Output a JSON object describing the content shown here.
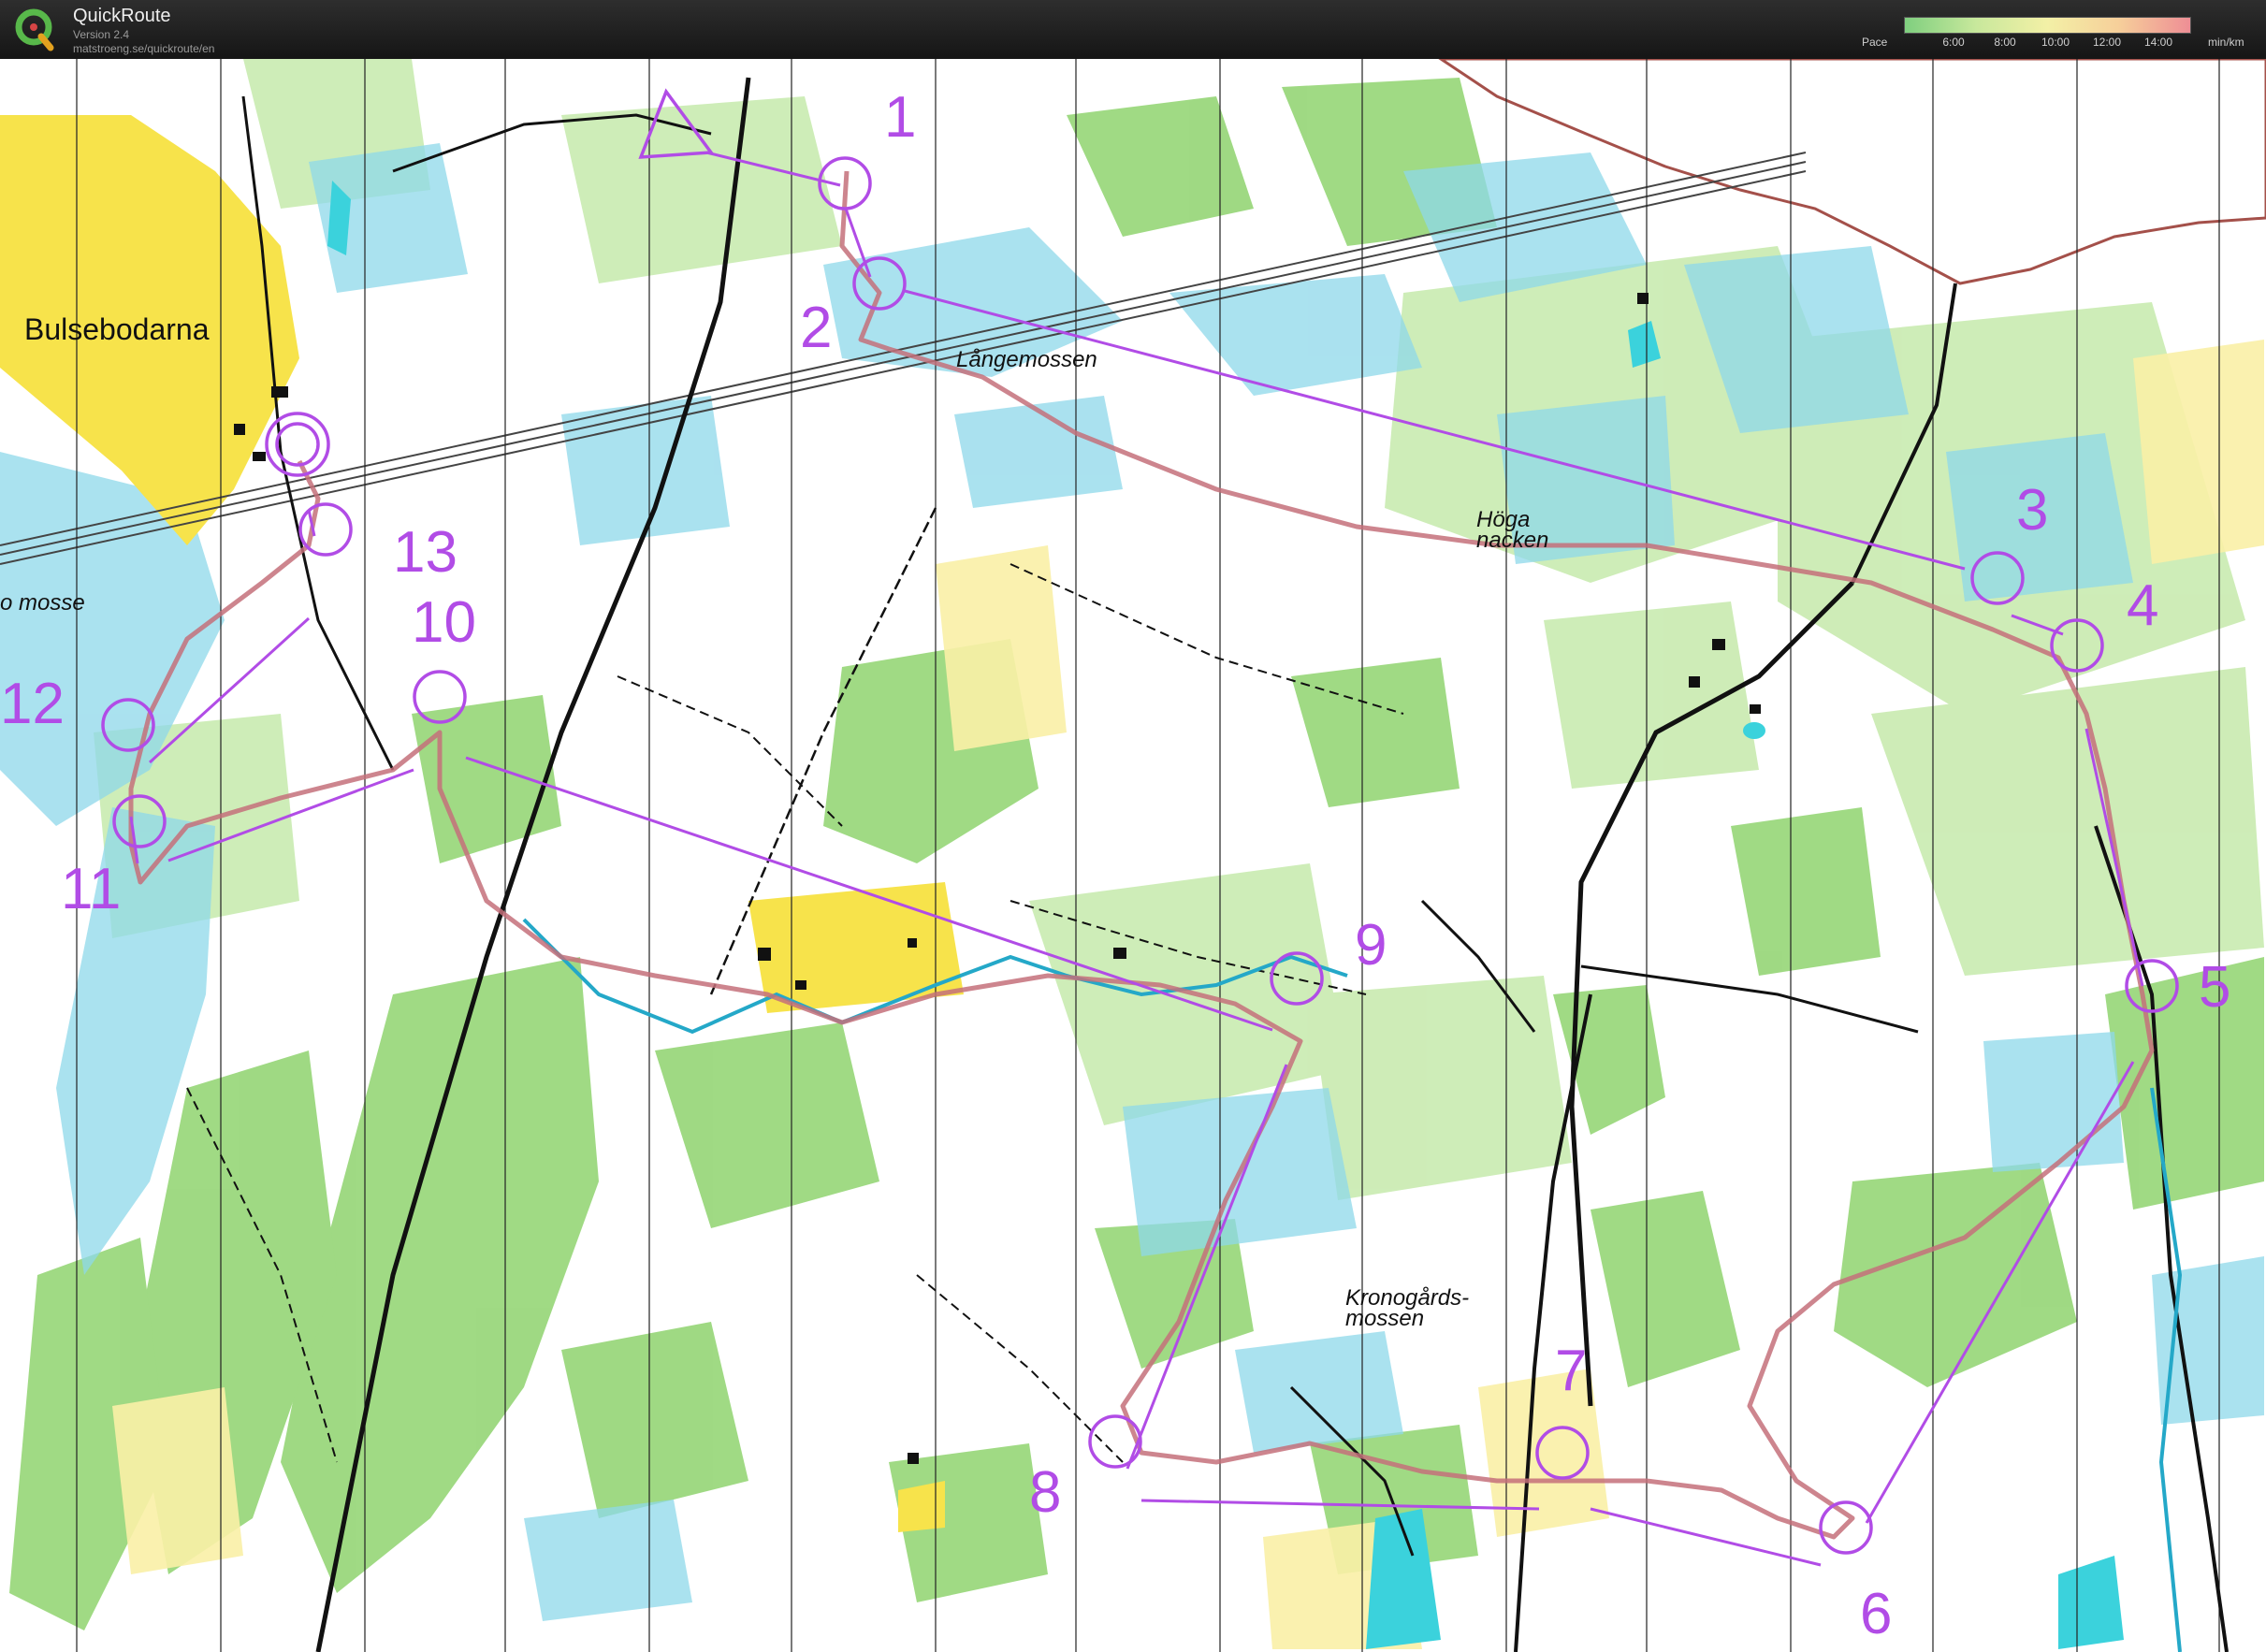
{
  "app": {
    "title": "QuickRoute",
    "version": "Version 2.4",
    "url": "matstroeng.se/quickroute/en"
  },
  "pace_legend": {
    "label": "Pace",
    "ticks": [
      "6:00",
      "8:00",
      "10:00",
      "12:00",
      "14:00"
    ],
    "unit": "min/km",
    "colors": [
      "#7fcf7f",
      "#c8e89c",
      "#f3f0a6",
      "#f6cf9a",
      "#ee8e95"
    ]
  },
  "map": {
    "place_names": {
      "bulsebodarna": "Bulsebodarna",
      "langemossen": "Långemossen",
      "hoga": "Höga",
      "nacken": "nacken",
      "mosse": "o mosse",
      "kronogards": "Kronogårds-",
      "kronogards_2": "mossen"
    },
    "colors": {
      "course": "#b14ce6",
      "route": "#c4707a",
      "open_land": "#f7e34b",
      "forest_green": "#8fd36e",
      "marsh": "#8ed8ea",
      "water": "#3bd2dc"
    },
    "controls": [
      "1",
      "2",
      "3",
      "4",
      "5",
      "6",
      "7",
      "8",
      "9",
      "10",
      "11",
      "12",
      "13"
    ]
  }
}
